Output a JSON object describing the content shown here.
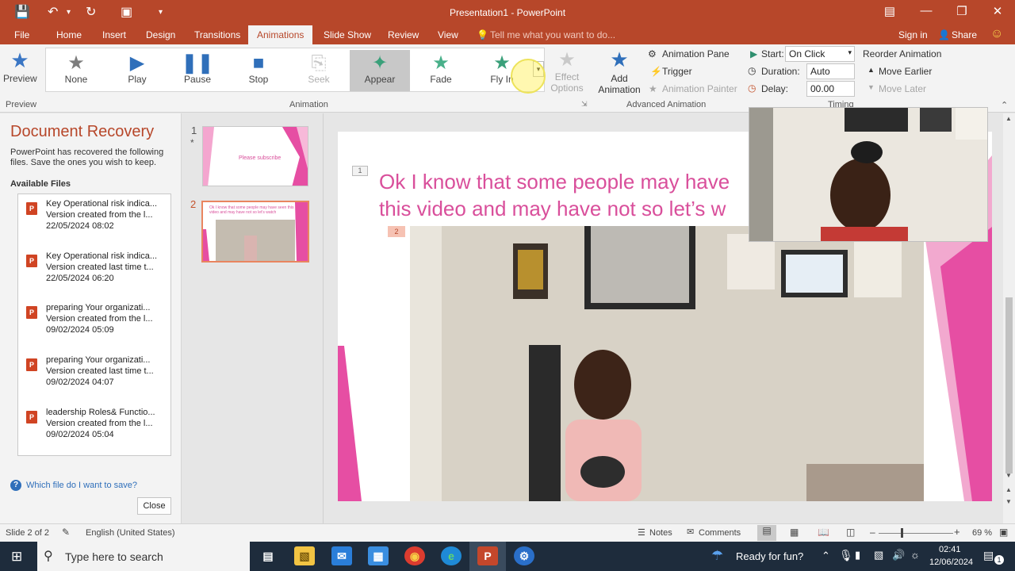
{
  "window": {
    "title": "Presentation1 - PowerPoint"
  },
  "tabs": [
    "File",
    "Home",
    "Insert",
    "Design",
    "Transitions",
    "Animations",
    "Slide Show",
    "Review",
    "View"
  ],
  "tell_me": "Tell me what you want to do...",
  "account": {
    "sign_in": "Sign in",
    "share": "Share"
  },
  "ribbon": {
    "preview_label": "Preview",
    "preview_group": "Preview",
    "animations": [
      "None",
      "Play",
      "Pause",
      "Stop",
      "Seek",
      "Appear",
      "Fade",
      "Fly In"
    ],
    "effect_options": "Effect Options",
    "animation_group": "Animation",
    "add_animation": "Add Animation",
    "animation_pane": "Animation Pane",
    "trigger": "Trigger",
    "animation_painter": "Animation Painter",
    "advanced_group": "Advanced Animation",
    "start_label": "Start:",
    "start_value": "On Click",
    "duration_label": "Duration:",
    "duration_value": "Auto",
    "delay_label": "Delay:",
    "delay_value": "00.00",
    "timing_group": "Timing",
    "reorder": "Reorder Animation",
    "move_earlier": "Move Earlier",
    "move_later": "Move Later"
  },
  "recovery": {
    "title": "Document Recovery",
    "description": "PowerPoint has recovered the following files.  Save the ones you wish to keep.",
    "available": "Available Files",
    "files": [
      {
        "name": "Key Operational risk indica...",
        "version": "Version created from the l...",
        "date": "22/05/2024 08:02"
      },
      {
        "name": "Key Operational risk indica...",
        "version": "Version created last time t...",
        "date": "22/05/2024 06:20"
      },
      {
        "name": "preparing Your organizati...",
        "version": "Version created from the l...",
        "date": "09/02/2024 05:09"
      },
      {
        "name": "preparing Your organizati...",
        "version": "Version created last time t...",
        "date": "09/02/2024 04:07"
      },
      {
        "name": "leadership Roles& Functio...",
        "version": "Version created from the l...",
        "date": "09/02/2024 05:04"
      }
    ],
    "help": "Which file do I want to save?",
    "close": "Close"
  },
  "thumbnails": [
    {
      "number": "1",
      "star": "*",
      "text": "Please subscribe"
    },
    {
      "number": "2",
      "text": "Ok I know that some people may have seen this video and may have not so let's watch"
    }
  ],
  "slide": {
    "marker1": "1",
    "marker2": "2",
    "line1": "Ok I know that some people may have",
    "line2": "this video and may have not so let’s w"
  },
  "status": {
    "slide": "Slide 2 of 2",
    "language": "English (United States)",
    "notes": "Notes",
    "comments": "Comments",
    "zoom": "69 %"
  },
  "taskbar": {
    "search": "Type here to search",
    "weather": "Ready for fun?",
    "time": "02:41",
    "date": "12/06/2024",
    "notifications": "1"
  },
  "colors": {
    "accent": "#b7472a",
    "slide_text": "#d94f9b",
    "pink": "#e64ea3"
  }
}
